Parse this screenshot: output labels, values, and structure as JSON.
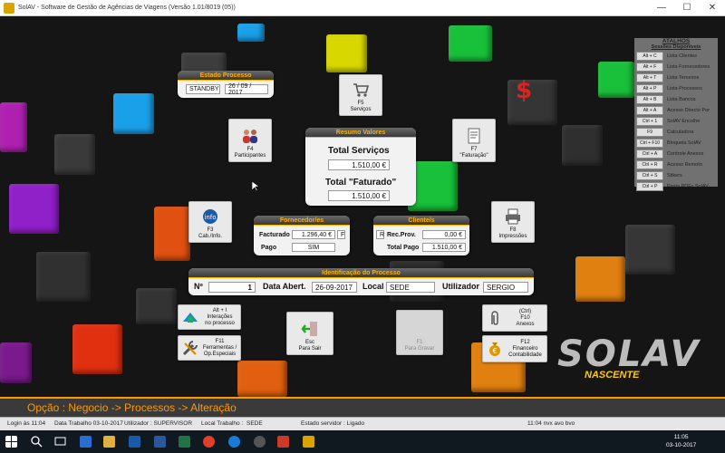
{
  "window": {
    "title": "SolAV - Software de Gestão de Agências de Viagens (Versão 1.01/8019 (05))",
    "min_glyph": "—",
    "max_glyph": "☐",
    "close_glyph": "✕"
  },
  "estado": {
    "header": "Estado Processo",
    "status": "STANDBY",
    "date": "26 / 09 / 2017"
  },
  "resumo": {
    "header": "Resumo Valores",
    "servicos_label": "Total Serviços",
    "servicos_value": "1.510,00 €",
    "faturado_label": "Total \"Faturado\"",
    "faturado_value": "1.510,00 €"
  },
  "fornecedor": {
    "header": "Fornecedor/es",
    "facturado_label": "Facturado",
    "facturado_value": "1.296,40 €",
    "facturado_flag": "F",
    "pago_label": "Pago",
    "pago_value": "SIM"
  },
  "cliente": {
    "header": "Cliente/s",
    "rec_flag": "R",
    "rec_label": "Rec.Prov.",
    "rec_value": "0,00 €",
    "total_label": "Total Pago",
    "total_value": "1.510,00 €"
  },
  "identificacao": {
    "header": "Identificação do Processo",
    "no_label": "Nº",
    "no_value": "1",
    "data_label": "Data Abert.",
    "data_value": "26-09-2017",
    "local_label": "Local",
    "local_value": "SEDE",
    "util_label": "Utilizador",
    "util_value": "SERGIO"
  },
  "buttons": {
    "f5": [
      "F5",
      "Serviços"
    ],
    "f4": [
      "F4",
      "Participantes"
    ],
    "f7": [
      "F7",
      "\"Faturação\""
    ],
    "f3": [
      "F3",
      "Cab./Info."
    ],
    "f8": [
      "F8",
      "Impressões"
    ],
    "alt1": [
      "Alt + I",
      "Interações",
      "no processo"
    ],
    "esc": [
      "Esc",
      "Para Sair"
    ],
    "f1": [
      "F1",
      "Para Gravar"
    ],
    "f10": [
      "(Ctrl)",
      "F10",
      "Anexos"
    ],
    "f11": [
      "F11",
      "Ferramentas /",
      "Op.Especiais"
    ],
    "f12": [
      "F12",
      "Financeiro",
      "Contabilidade"
    ]
  },
  "atalhos": {
    "header": "ATALHOS",
    "subheader": "Sessões Disponíveis",
    "items": [
      {
        "key": "Alt + C",
        "label": "Lista Clientes"
      },
      {
        "key": "Alt + F",
        "label": "Lista Fornecedores"
      },
      {
        "key": "Alt + T",
        "label": "Lista Terceiros"
      },
      {
        "key": "Alt + P",
        "label": "Lista Processos"
      },
      {
        "key": "Alt + B",
        "label": "Lista Bancos"
      },
      {
        "key": "Alt + A",
        "label": "Acesso Directo Por"
      },
      {
        "key": "Ctrl + 1",
        "label": "SolAV Encolhe"
      },
      {
        "key": "F9",
        "label": "Calculadora"
      },
      {
        "key": "Ctrl + F10",
        "label": "Bloqueia SolAV"
      },
      {
        "key": "Ctrl + A",
        "label": "Controle Anexos"
      },
      {
        "key": "Ctrl + R",
        "label": "Acesso Remoto"
      },
      {
        "key": "Ctrl + S",
        "label": "Stikers"
      },
      {
        "key": "Ctrl + P",
        "label": "Pasta PDFs SolAV"
      }
    ]
  },
  "opcao": "Opção : Negocio -> Processos -> Alteração",
  "status": {
    "login": "Login às 11:04",
    "data_trabalho": "Data Trabalho 03-10-2017",
    "utilizador": "Utilizador : SUPERVISOR",
    "local_label": "Local Trabalho :",
    "local_value": "SEDE",
    "servidor": "Estado servidor : Ligado",
    "time": "11:04 nvx avo bvo"
  },
  "taskbar": {
    "time": "11:05",
    "date": "03-10-2017"
  },
  "logo": {
    "word": "SOLAV",
    "sub": "NASCENTE"
  },
  "colors": {
    "accent": "#ff9900",
    "panel_head": "#4a4a4a"
  }
}
